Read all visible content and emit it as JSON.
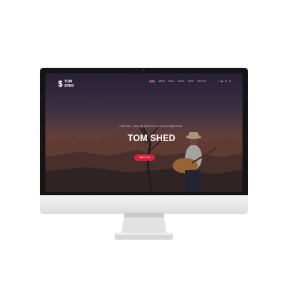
{
  "site": {
    "logo_mark": "$",
    "logo_text": "TOM SHED",
    "nav": [
      {
        "label": "HOME",
        "active": true
      },
      {
        "label": "ABOUT",
        "active": false
      },
      {
        "label": "BLOG",
        "active": false
      },
      {
        "label": "MUSIC",
        "active": false
      },
      {
        "label": "SHOP",
        "active": false
      },
      {
        "label": "CONTACT",
        "active": false
      }
    ],
    "social_icons": [
      "facebook-icon",
      "youtube-icon",
      "linkedin-icon",
      "instagram-icon"
    ],
    "social_glyphs": [
      "f",
      "▶",
      "in",
      "◎"
    ]
  },
  "hero": {
    "tagline": "HISTORY, HUMOR AND THE HUMAN CONDITION",
    "title": "TOM SHED",
    "button_label": "MEET TOM"
  },
  "colors": {
    "accent": "#d1243d",
    "bezel": "#151515",
    "text": "#ffffff"
  }
}
